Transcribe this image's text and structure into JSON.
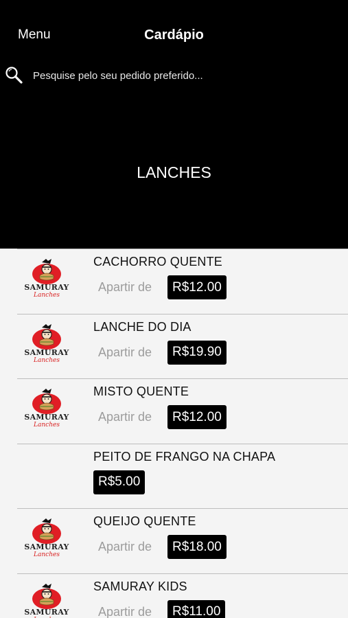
{
  "nav": {
    "menu_label": "Menu",
    "title": "Cardápio"
  },
  "search": {
    "placeholder": "Pesquise pelo seu pedido preferido...",
    "icon": "search-icon"
  },
  "category": {
    "title": "LANCHES"
  },
  "logo": {
    "brand": "SAMURAY",
    "subtitle": "Lanches"
  },
  "items": [
    {
      "name": "CACHORRO QUENTE",
      "price_prefix": "Apartir de",
      "price": "R$12.00",
      "has_logo": true
    },
    {
      "name": "LANCHE DO DIA",
      "price_prefix": "Apartir de",
      "price": "R$19.90",
      "has_logo": true
    },
    {
      "name": "MISTO QUENTE",
      "price_prefix": "Apartir de",
      "price": "R$12.00",
      "has_logo": true
    },
    {
      "name": "PEITO DE FRANGO NA CHAPA",
      "price": "R$5.00",
      "has_logo": false
    },
    {
      "name": "QUEIJO QUENTE",
      "price_prefix": "Apartir de",
      "price": "R$18.00",
      "has_logo": true
    },
    {
      "name": "SAMURAY KIDS",
      "price_prefix": "Apartir de",
      "price": "R$11.00",
      "has_logo": true
    }
  ],
  "colors": {
    "header_bg": "#000000",
    "list_bg": "#f4f4f4",
    "price_badge_bg": "#000000",
    "logo_red": "#e01e25"
  }
}
